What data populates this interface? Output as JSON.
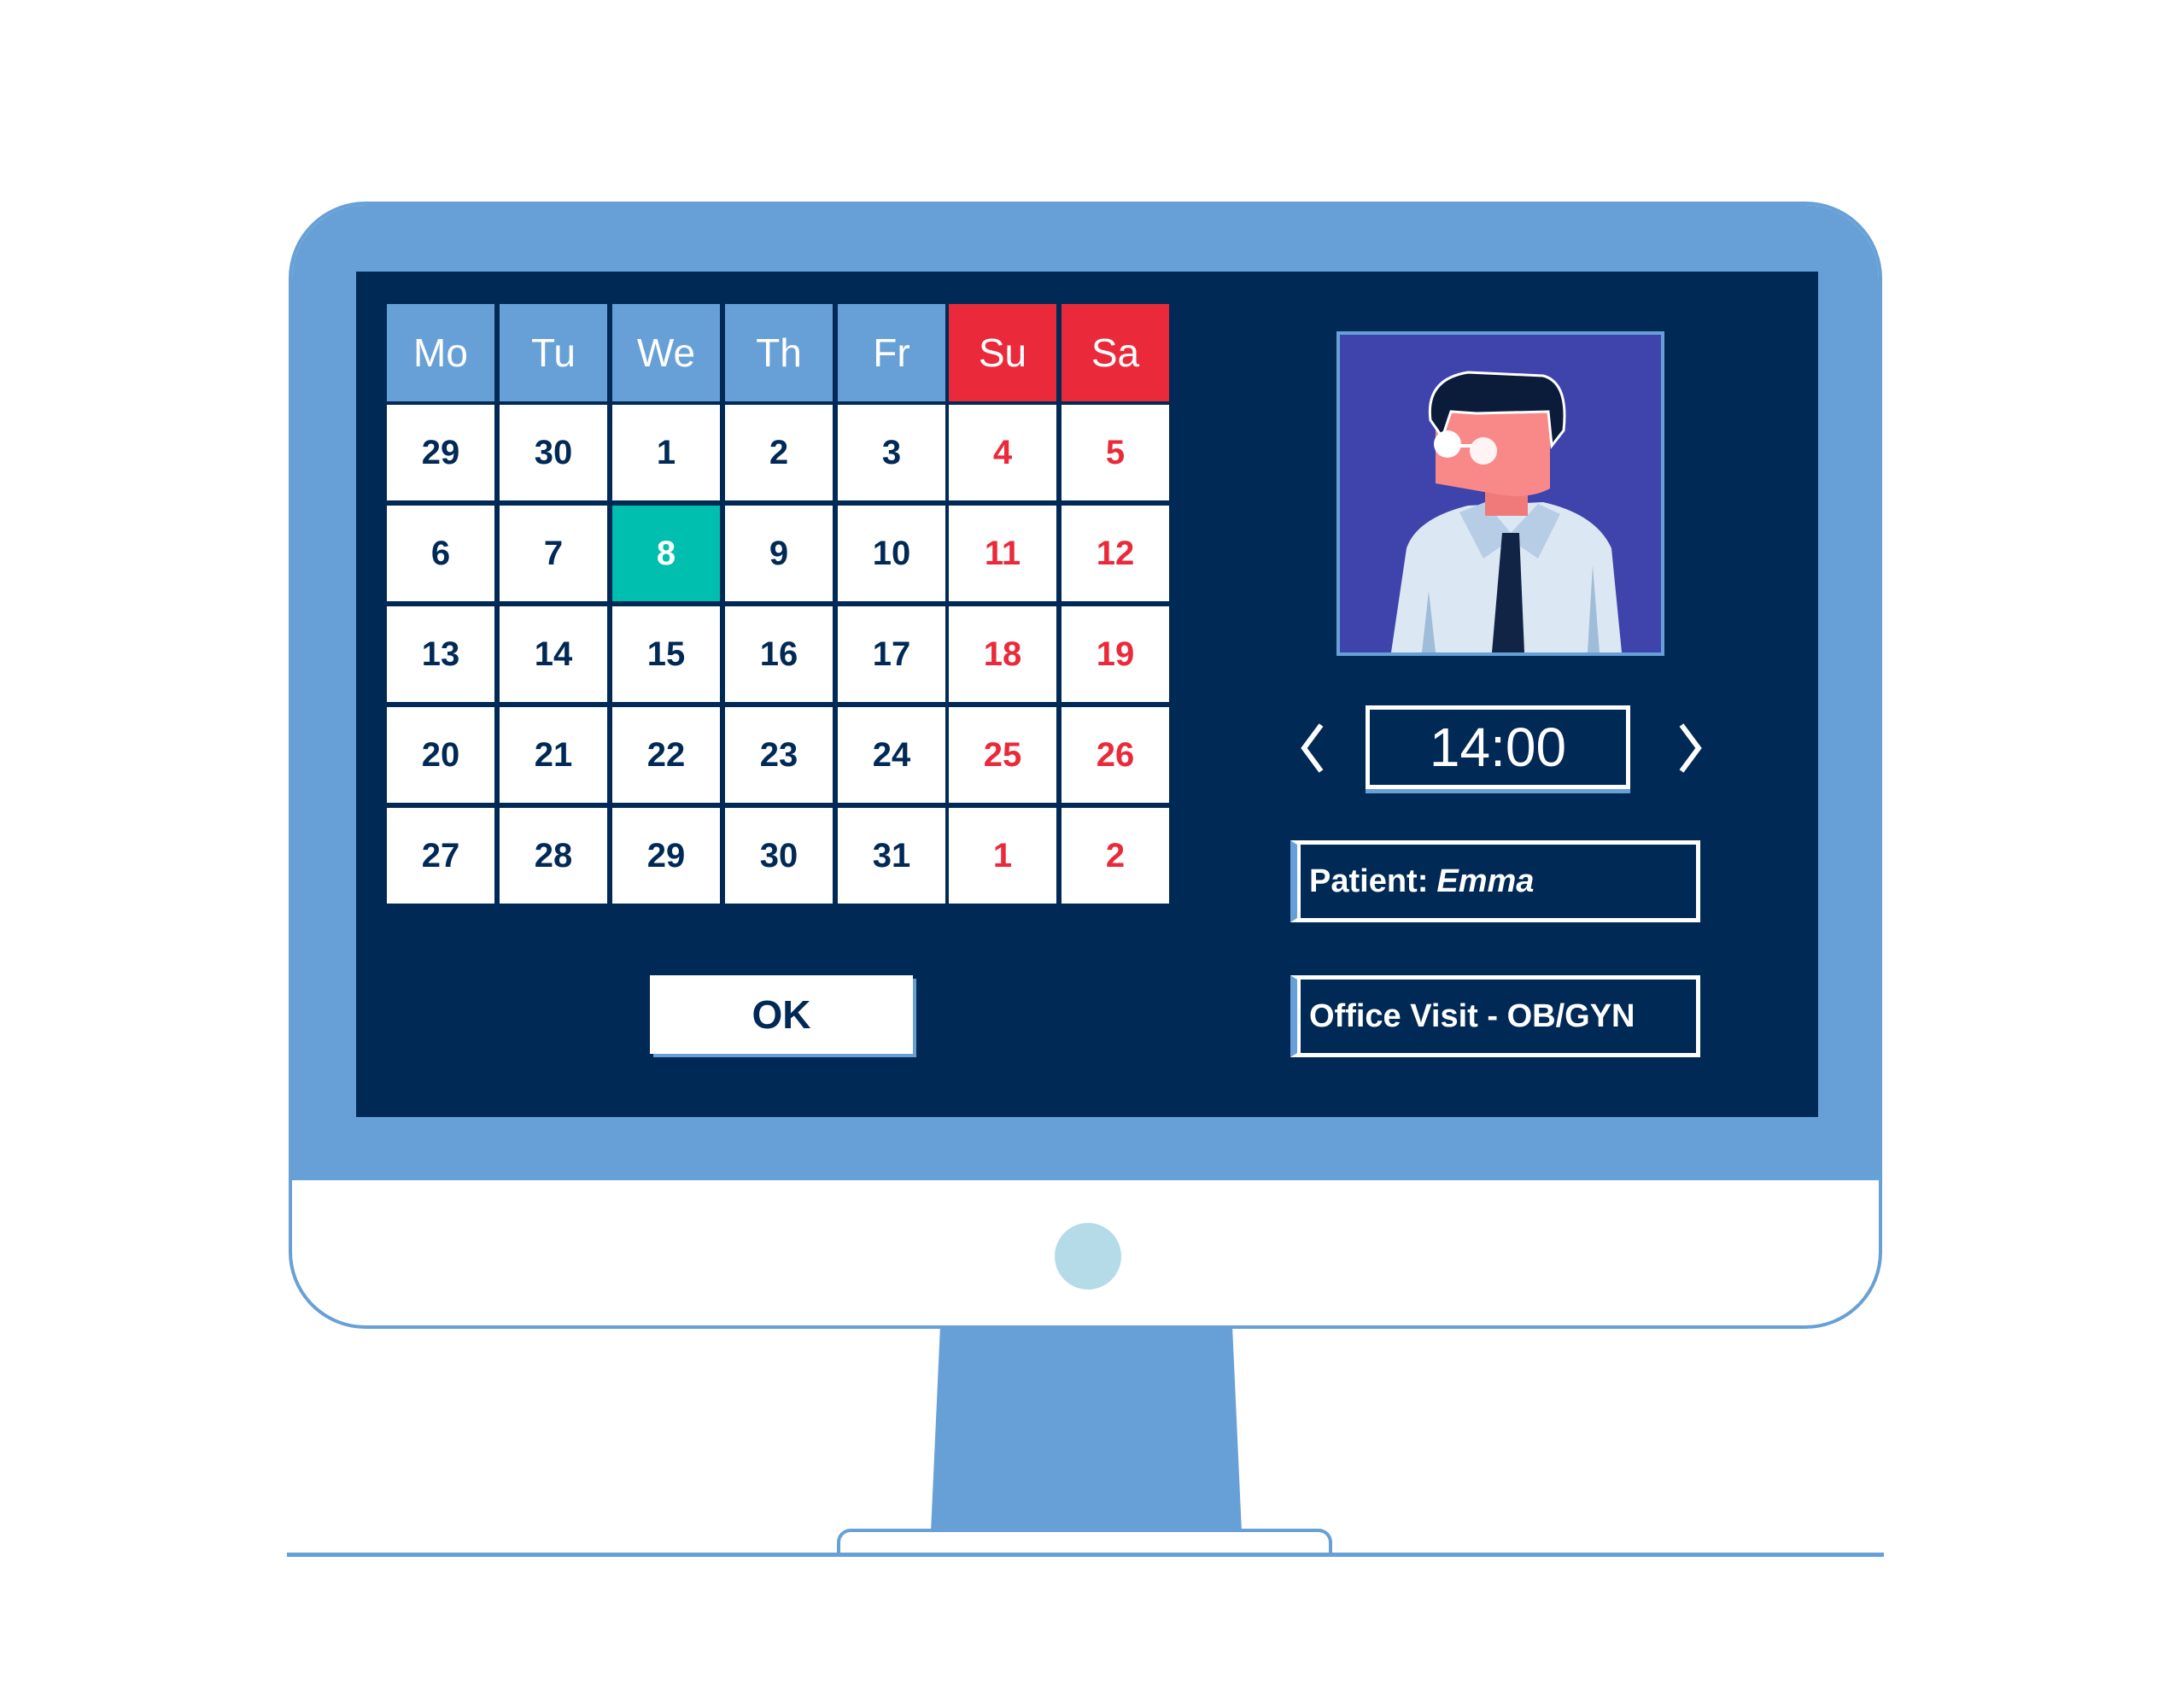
{
  "calendar": {
    "weekdays": [
      "Mo",
      "Tu",
      "We",
      "Th",
      "Fr",
      "Su",
      "Sa"
    ],
    "weeks": [
      [
        "29",
        "30",
        "1",
        "2",
        "3",
        "4",
        "5"
      ],
      [
        "6",
        "7",
        "8",
        "9",
        "10",
        "11",
        "12"
      ],
      [
        "13",
        "14",
        "15",
        "16",
        "17",
        "18",
        "19"
      ],
      [
        "20",
        "21",
        "22",
        "23",
        "24",
        "25",
        "26"
      ],
      [
        "27",
        "28",
        "29",
        "30",
        "31",
        "1",
        "2"
      ]
    ],
    "selected_day": "8"
  },
  "ok_button": {
    "label": "OK"
  },
  "time": {
    "value": "14:00"
  },
  "patient": {
    "label": "Patient:",
    "name": "Emma"
  },
  "visit": {
    "type": "Office Visit - OB/GYN"
  },
  "colors": {
    "screen": "#012955",
    "bezel": "#67a0d7",
    "weekend": "#ea2a3a",
    "selected": "#00bfae",
    "avatar_bg": "#3f43ac"
  },
  "icons": {
    "prev": "chevron-left-icon",
    "next": "chevron-right-icon",
    "avatar": "doctor-avatar-illustration"
  }
}
